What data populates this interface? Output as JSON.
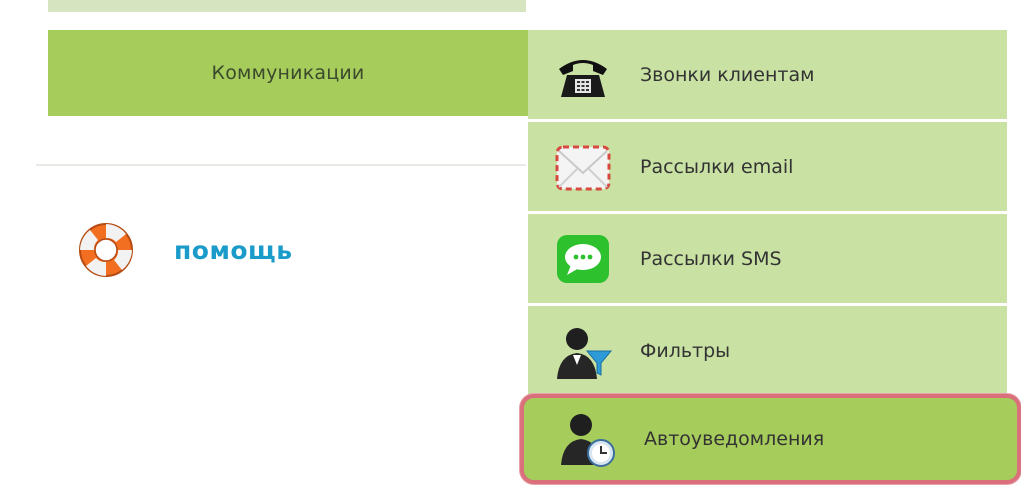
{
  "main_menu": {
    "label": "Коммуникации"
  },
  "help": {
    "label": "помощь",
    "icon": "lifebuoy-icon"
  },
  "submenu": {
    "items": [
      {
        "label": "Звонки клиентам",
        "icon": "phone-icon"
      },
      {
        "label": "Рассылки email",
        "icon": "envelope-icon"
      },
      {
        "label": "Рассылки SMS",
        "icon": "sms-bubble-icon"
      },
      {
        "label": "Фильтры",
        "icon": "user-filter-icon"
      },
      {
        "label": "Автоуведомления",
        "icon": "user-clock-icon"
      }
    ]
  },
  "colors": {
    "menu_green": "#a6cc5c",
    "submenu_light_green": "#c9e2a4",
    "help_blue": "#1a9bc9",
    "highlight_border": "#d9707c"
  }
}
